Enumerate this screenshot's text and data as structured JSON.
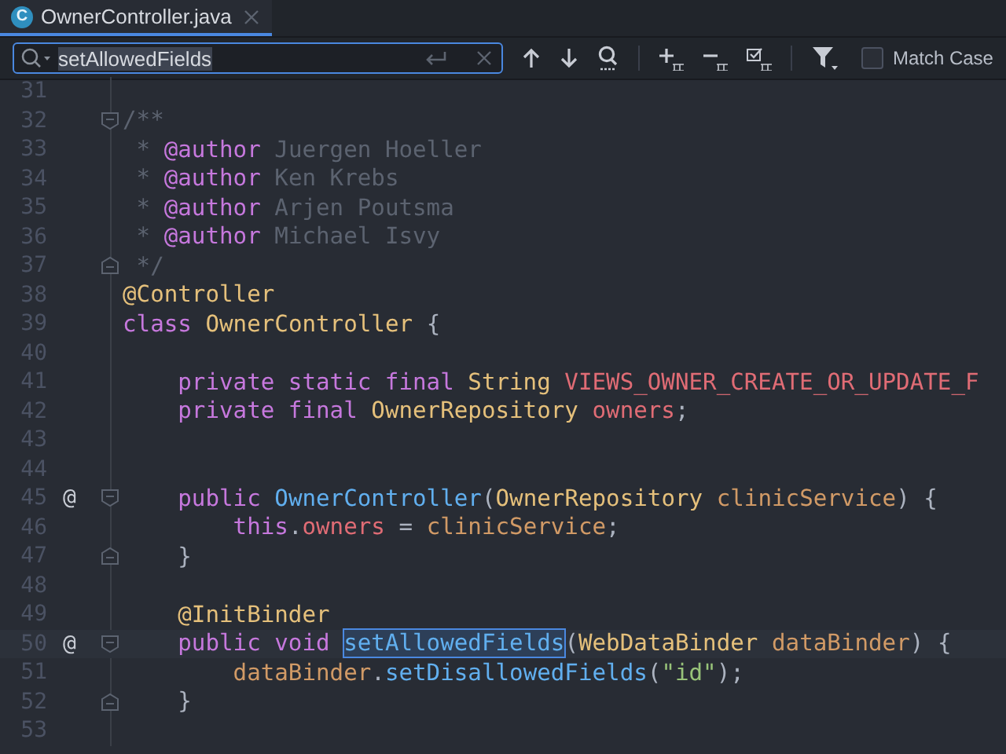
{
  "tabs": [
    {
      "icon_letter": "C",
      "label": "OwnerController.java",
      "selected": true
    }
  ],
  "find_bar": {
    "query": "setAllowedFields",
    "match_case": {
      "label": "Match Case",
      "checked": false
    }
  },
  "editor": {
    "lines": [
      {
        "number": "31",
        "fold_start": false,
        "fold_end": false
      },
      {
        "number": "32",
        "fold_start": true,
        "fold_end": false,
        "tokens": [
          {
            "kind": "comment",
            "text": "/**"
          }
        ]
      },
      {
        "number": "33",
        "fold_start": false,
        "fold_end": false,
        "tokens": [
          {
            "kind": "comment",
            "text": " * "
          },
          {
            "kind": "tag",
            "text": "@author"
          },
          {
            "kind": "comment",
            "text": " Juergen Hoeller"
          }
        ]
      },
      {
        "number": "34",
        "fold_start": false,
        "fold_end": false,
        "tokens": [
          {
            "kind": "comment",
            "text": " * "
          },
          {
            "kind": "tag",
            "text": "@author"
          },
          {
            "kind": "comment",
            "text": " Ken Krebs"
          }
        ]
      },
      {
        "number": "35",
        "fold_start": false,
        "fold_end": false,
        "tokens": [
          {
            "kind": "comment",
            "text": " * "
          },
          {
            "kind": "tag",
            "text": "@author"
          },
          {
            "kind": "comment",
            "text": " Arjen Poutsma"
          }
        ]
      },
      {
        "number": "36",
        "fold_start": false,
        "fold_end": false,
        "tokens": [
          {
            "kind": "comment",
            "text": " * "
          },
          {
            "kind": "tag",
            "text": "@author"
          },
          {
            "kind": "comment",
            "text": " Michael Isvy"
          }
        ]
      },
      {
        "number": "37",
        "fold_start": false,
        "fold_end": true,
        "tokens": [
          {
            "kind": "comment",
            "text": " */"
          }
        ]
      },
      {
        "number": "38",
        "fold_start": false,
        "fold_end": false,
        "tokens": [
          {
            "kind": "annotation",
            "text": "@Controller"
          }
        ]
      },
      {
        "number": "39",
        "fold_start": false,
        "fold_end": false,
        "tokens": [
          {
            "kind": "keyword",
            "text": "class"
          },
          {
            "kind": "type",
            "text": " OwnerController"
          },
          {
            "kind": "plain",
            "text": " {"
          }
        ]
      },
      {
        "number": "40",
        "fold_start": false,
        "fold_end": false
      },
      {
        "number": "41",
        "fold_start": false,
        "fold_end": false,
        "tokens": [
          {
            "kind": "keyword",
            "text": "    private static final"
          },
          {
            "kind": "type",
            "text": " String"
          },
          {
            "kind": "constant",
            "text": " VIEWS_OWNER_CREATE_OR_UPDATE_F"
          }
        ]
      },
      {
        "number": "42",
        "fold_start": false,
        "fold_end": false,
        "tokens": [
          {
            "kind": "keyword",
            "text": "    private final"
          },
          {
            "kind": "type",
            "text": " OwnerRepository"
          },
          {
            "kind": "field",
            "text": " owners"
          },
          {
            "kind": "plain",
            "text": ";"
          }
        ]
      },
      {
        "number": "43",
        "fold_start": false,
        "fold_end": false
      },
      {
        "number": "44",
        "fold_start": false,
        "fold_end": false
      },
      {
        "number": "45",
        "mark": "@",
        "fold_start": true,
        "fold_end": false,
        "tokens": [
          {
            "kind": "keyword",
            "text": "    public"
          },
          {
            "kind": "method",
            "text": " OwnerController"
          },
          {
            "kind": "plain",
            "text": "("
          },
          {
            "kind": "type",
            "text": "OwnerRepository"
          },
          {
            "kind": "param",
            "text": " clinicService"
          },
          {
            "kind": "plain",
            "text": ") {"
          }
        ]
      },
      {
        "number": "46",
        "fold_start": false,
        "fold_end": false,
        "tokens": [
          {
            "kind": "keyword",
            "text": "        this"
          },
          {
            "kind": "plain",
            "text": "."
          },
          {
            "kind": "field",
            "text": "owners"
          },
          {
            "kind": "plain",
            "text": " = "
          },
          {
            "kind": "param",
            "text": "clinicService"
          },
          {
            "kind": "plain",
            "text": ";"
          }
        ]
      },
      {
        "number": "47",
        "fold_start": false,
        "fold_end": true,
        "tokens": [
          {
            "kind": "plain",
            "text": "    }"
          }
        ]
      },
      {
        "number": "48",
        "fold_start": false,
        "fold_end": false
      },
      {
        "number": "49",
        "fold_start": false,
        "fold_end": false,
        "tokens": [
          {
            "kind": "annotation",
            "text": "    @InitBinder"
          }
        ]
      },
      {
        "number": "50",
        "mark": "@",
        "fold_start": true,
        "fold_end": false,
        "current": true,
        "tokens": [
          {
            "kind": "keyword",
            "text": "    public void "
          },
          {
            "kind": "method",
            "text": "setAllowedFields",
            "match": true
          },
          {
            "kind": "plain",
            "text": "("
          },
          {
            "kind": "type",
            "text": "WebDataBinder"
          },
          {
            "kind": "param",
            "text": " dataBinder"
          },
          {
            "kind": "plain",
            "text": ") {"
          }
        ]
      },
      {
        "number": "51",
        "fold_start": false,
        "fold_end": false,
        "tokens": [
          {
            "kind": "param",
            "text": "        dataBinder"
          },
          {
            "kind": "plain",
            "text": "."
          },
          {
            "kind": "method",
            "text": "setDisallowedFields"
          },
          {
            "kind": "plain",
            "text": "("
          },
          {
            "kind": "string",
            "text": "\"id\""
          },
          {
            "kind": "plain",
            "text": ");"
          }
        ]
      },
      {
        "number": "52",
        "fold_start": false,
        "fold_end": true,
        "tokens": [
          {
            "kind": "plain",
            "text": "    }"
          }
        ]
      },
      {
        "number": "53",
        "fold_start": false,
        "fold_end": false
      }
    ]
  }
}
